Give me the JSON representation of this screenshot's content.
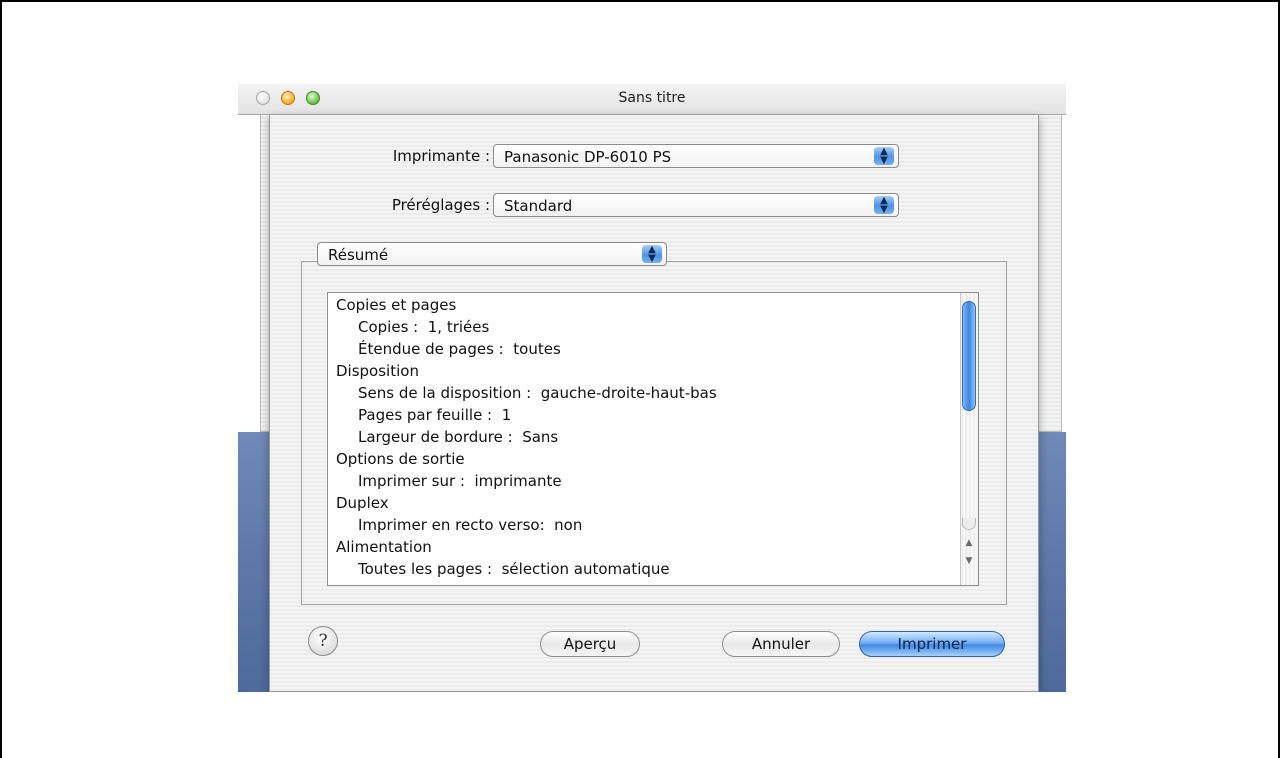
{
  "window": {
    "title": "Sans titre"
  },
  "printer": {
    "label": "Imprimante :",
    "value": "Panasonic DP-6010 PS"
  },
  "presets": {
    "label": "Préréglages :",
    "value": "Standard"
  },
  "panel_selector": {
    "value": "Résumé"
  },
  "summary": {
    "lines": [
      "Copies et pages",
      "Copies :  1, triées",
      "Étendue de pages :  toutes",
      "Disposition",
      "Sens de la disposition :  gauche-droite-haut-bas",
      "Pages par feuille :  1",
      "Largeur de bordure :  Sans",
      "Options de sortie",
      "Imprimer sur :  imprimante",
      "Duplex",
      "Imprimer en recto verso:  non",
      "Alimentation",
      "Toutes les pages :  sélection automatique"
    ]
  },
  "buttons": {
    "help": "?",
    "preview": "Aperçu",
    "cancel": "Annuler",
    "print": "Imprimer"
  },
  "icons": {
    "popup": "up-down-arrows-icon",
    "scroll_up": "▲",
    "scroll_down": "▼"
  }
}
